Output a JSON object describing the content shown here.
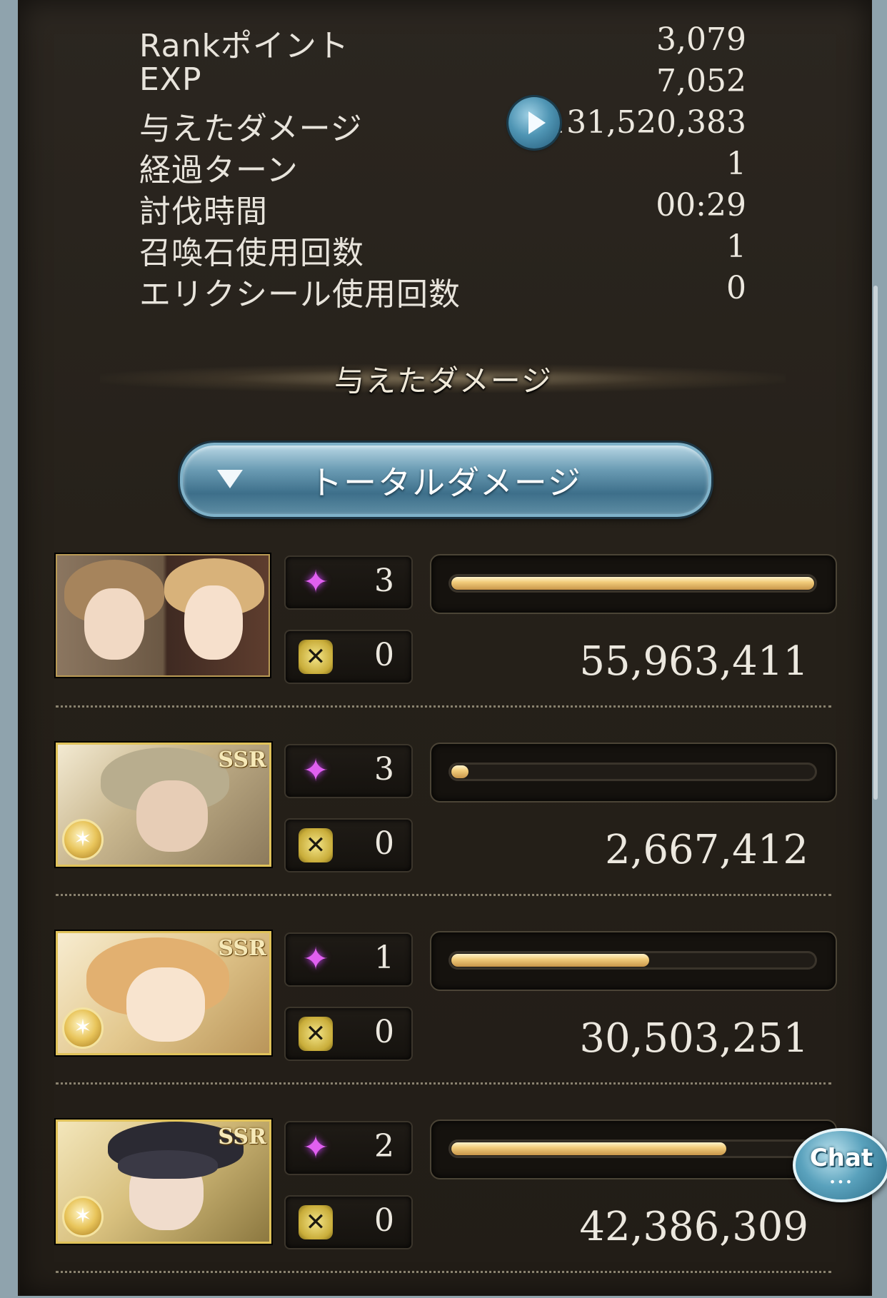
{
  "stats": [
    {
      "label": "Rankポイント",
      "value": "3,079"
    },
    {
      "label": "EXP",
      "value": "7,052"
    },
    {
      "label": "与えたダメージ",
      "value": "131,520,383"
    },
    {
      "label": "経過ターン",
      "value": "1"
    },
    {
      "label": "討伐時間",
      "value": "00:29"
    },
    {
      "label": "召喚石使用回数",
      "value": "1"
    },
    {
      "label": "エリクシール使用回数",
      "value": "0"
    }
  ],
  "damage_section": {
    "title": "与えたダメージ",
    "dropdown_label": "トータルダメージ"
  },
  "characters": [
    {
      "ougi_count": "3",
      "cycle_count": "0",
      "damage": "55,963,411",
      "damage_share": 1.0,
      "rarity_badge": ""
    },
    {
      "ougi_count": "3",
      "cycle_count": "0",
      "damage": "2,667,412",
      "damage_share": 0.048,
      "rarity_badge": "SSR"
    },
    {
      "ougi_count": "1",
      "cycle_count": "0",
      "damage": "30,503,251",
      "damage_share": 0.545,
      "rarity_badge": "SSR"
    },
    {
      "ougi_count": "2",
      "cycle_count": "0",
      "damage": "42,386,309",
      "damage_share": 0.757,
      "rarity_badge": "SSR"
    }
  ],
  "chat": {
    "label": "Chat",
    "dots": "•••"
  },
  "icons": {
    "ougi": "sparkle-icon",
    "cycle": "crossed-swords-icon",
    "play": "play-icon",
    "dropdown": "triangle-down-icon",
    "element": "light-element-icon"
  },
  "colors": {
    "panel": "#252019",
    "bar_fill": "#f2cd7c",
    "ougi_icon": "#e060f0",
    "button_blue": "#4f95b4"
  }
}
